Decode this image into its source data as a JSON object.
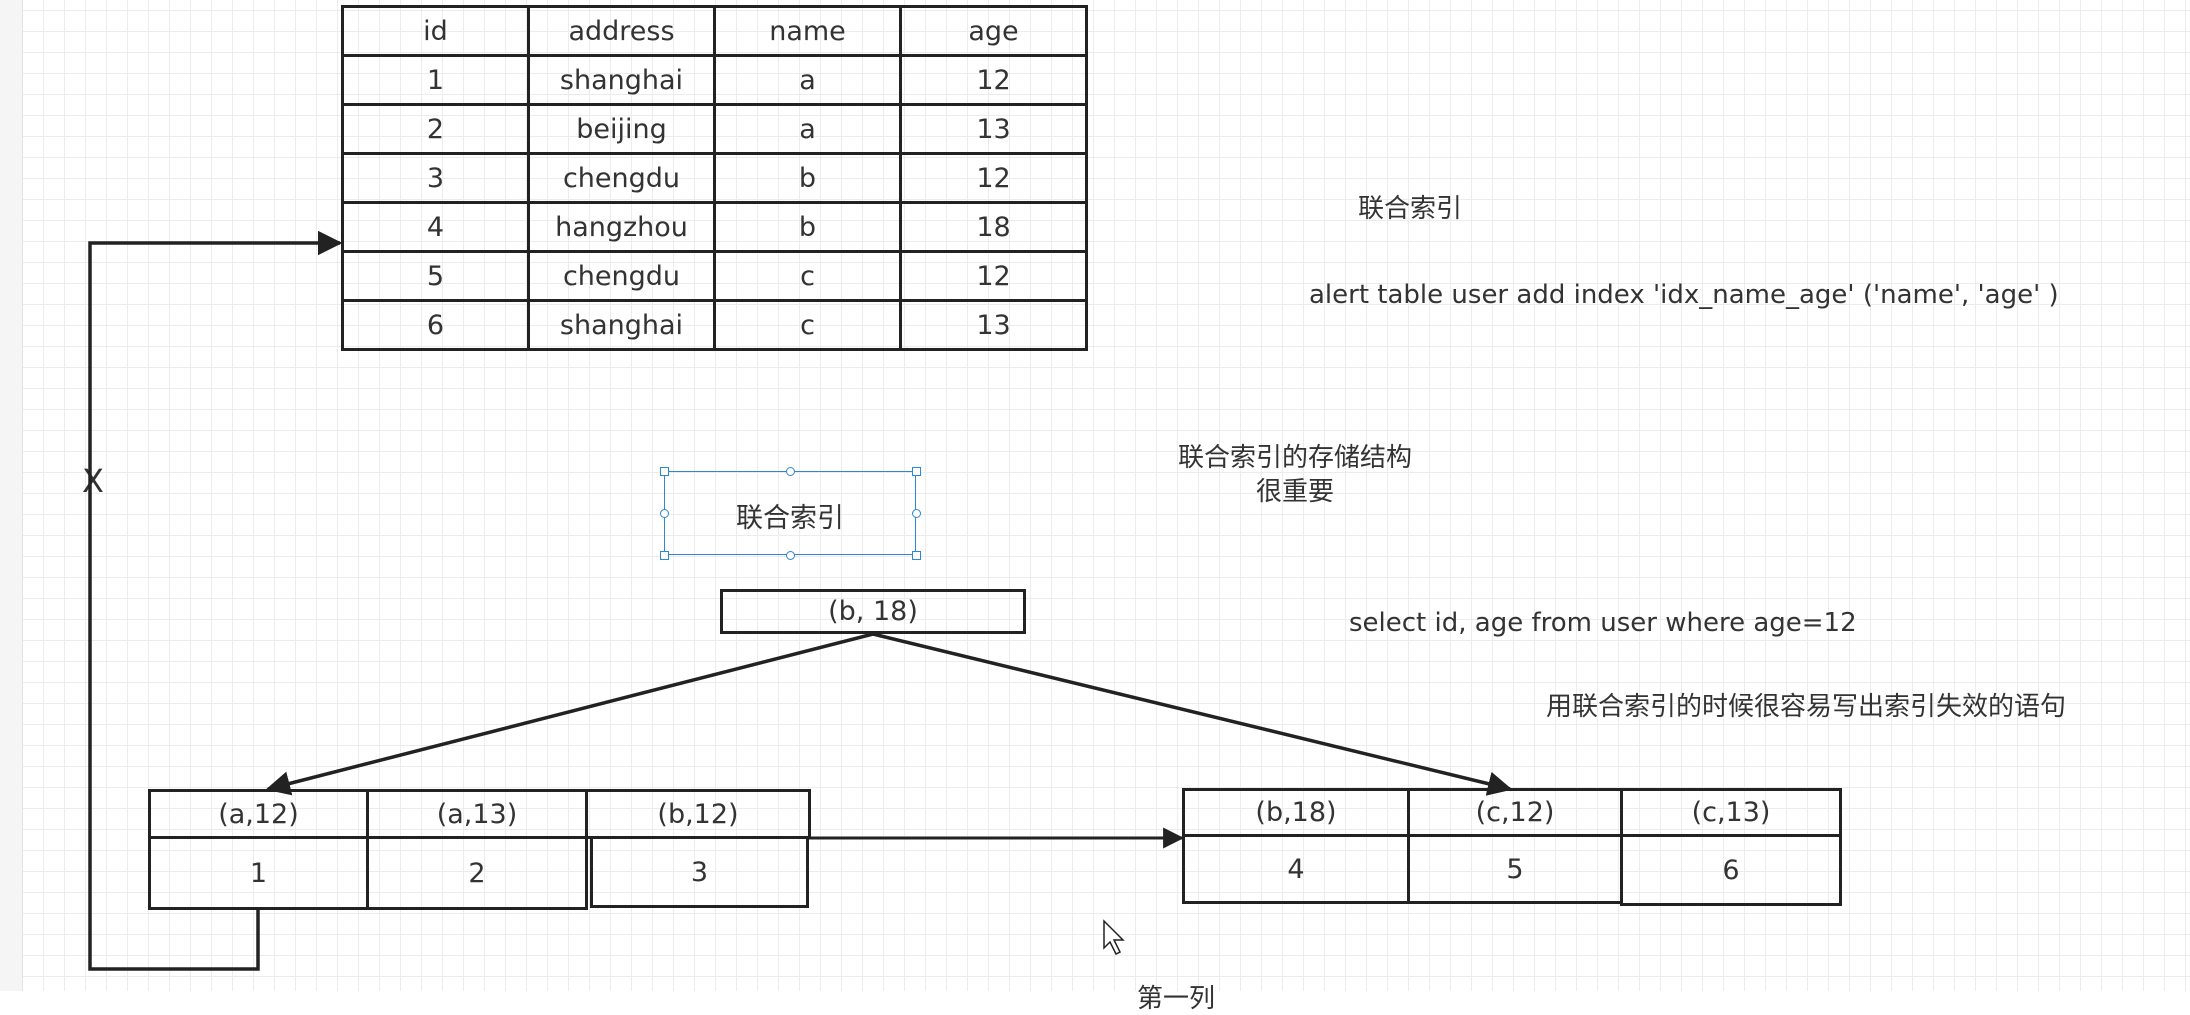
{
  "table": {
    "headers": [
      "id",
      "address",
      "name",
      "age"
    ],
    "rows": [
      [
        "1",
        "shanghai",
        "a",
        "12"
      ],
      [
        "2",
        "beijing",
        "a",
        "13"
      ],
      [
        "3",
        "chengdu",
        "b",
        "12"
      ],
      [
        "4",
        "hangzhou",
        "b",
        "18"
      ],
      [
        "5",
        "chengdu",
        "c",
        "12"
      ],
      [
        "6",
        "shanghai",
        "c",
        "13"
      ]
    ]
  },
  "notes": {
    "joint_index": "联合索引",
    "alter_sql": "alert table user add index 'idx_name_age' ('name', 'age'  )",
    "storage_line1": "联合索引的存储结构",
    "storage_line2": "很重要",
    "select_sql": "select id, age from user where age=12",
    "warning": "用联合索引的时候很容易写出索引失效的语句",
    "bottom_cut": "第一列"
  },
  "selected_box": {
    "label": "联合索引"
  },
  "tree": {
    "root": "(b, 18)",
    "left_leaf": {
      "keys": [
        "(a,12)",
        "(a,13)",
        "(b,12)"
      ],
      "values": [
        "1",
        "2",
        "3"
      ]
    },
    "right_leaf": {
      "keys": [
        "(b,18)",
        "(c,12)",
        "(c,13)"
      ],
      "values": [
        "4",
        "5",
        "6"
      ]
    }
  },
  "x_mark": "X",
  "colors": {
    "stroke": "#222222",
    "selection": "#2d86d6",
    "grid": "#ececec"
  }
}
